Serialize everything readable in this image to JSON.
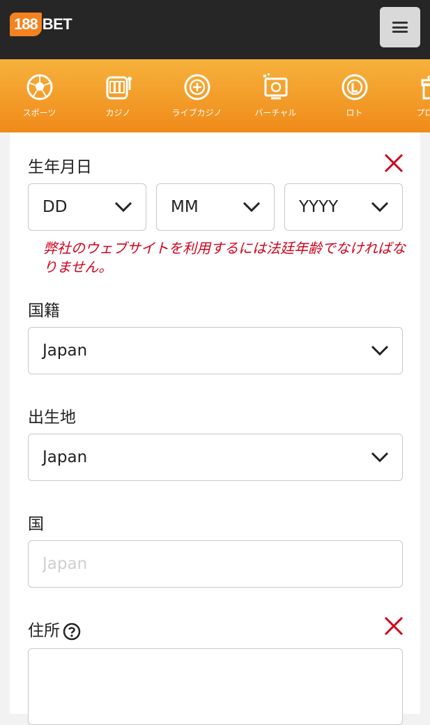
{
  "header": {
    "logo_number": "188",
    "logo_text": "BET",
    "menu_icon": "hamburger-menu-icon"
  },
  "nav": {
    "items": [
      {
        "label": "スポーツ",
        "icon": "soccer-ball-icon"
      },
      {
        "label": "カジノ",
        "icon": "slot-machine-icon"
      },
      {
        "label": "ライブカジノ",
        "icon": "roulette-chip-icon"
      },
      {
        "label": "バーチャル",
        "icon": "virtual-screen-icon"
      },
      {
        "label": "ロト",
        "icon": "lotto-ball-icon"
      },
      {
        "label": "プロモー",
        "icon": "gift-icon"
      }
    ]
  },
  "form": {
    "dob": {
      "label": "生年月日",
      "day": "DD",
      "month": "MM",
      "year": "YYYY",
      "error": "弊社のウェブサイトを利用するには法廷年齢でなければなりません。"
    },
    "nationality": {
      "label": "国籍",
      "value": "Japan"
    },
    "birthplace": {
      "label": "出生地",
      "value": "Japan"
    },
    "country": {
      "label": "国",
      "placeholder": "Japan"
    },
    "address": {
      "label": "住所",
      "value": ""
    }
  },
  "colors": {
    "accent": "#f58220",
    "error": "#d0021b",
    "header_bg": "#262626"
  }
}
